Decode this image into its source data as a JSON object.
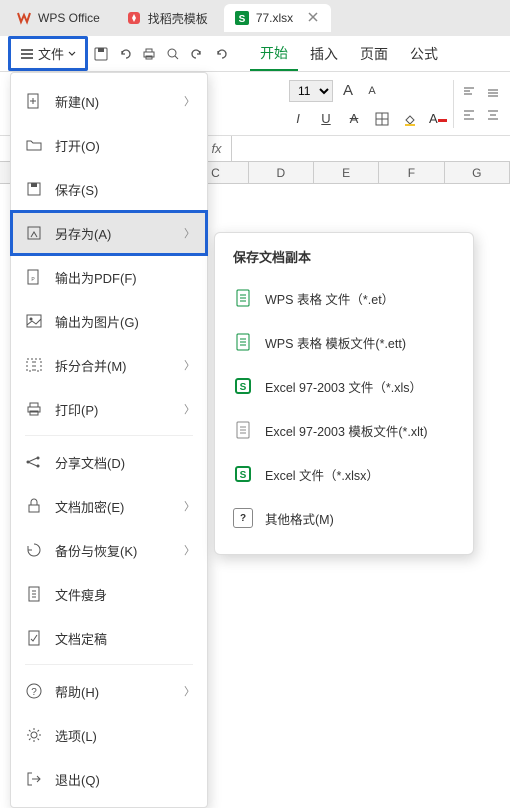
{
  "tabs": [
    {
      "label": "WPS Office",
      "icon": "wps"
    },
    {
      "label": "找稻壳模板",
      "icon": "docer"
    },
    {
      "label": "77.xlsx",
      "icon": "sheet",
      "active": true
    }
  ],
  "file_btn": "文件",
  "menu_tabs": [
    {
      "label": "开始",
      "active": true
    },
    {
      "label": "插入"
    },
    {
      "label": "页面"
    },
    {
      "label": "公式"
    }
  ],
  "ribbon": {
    "font_size": "11",
    "a_large": "A",
    "a_small": "A"
  },
  "fx_label": "fx",
  "columns": [
    "C",
    "D",
    "E",
    "F",
    "G"
  ],
  "file_menu": [
    {
      "label": "新建(N)",
      "icon": "new",
      "arrow": true
    },
    {
      "label": "打开(O)",
      "icon": "open"
    },
    {
      "label": "保存(S)",
      "icon": "save"
    },
    {
      "label": "另存为(A)",
      "icon": "saveas",
      "arrow": true,
      "highlight": true,
      "boxed": true
    },
    {
      "label": "输出为PDF(F)",
      "icon": "pdf"
    },
    {
      "label": "输出为图片(G)",
      "icon": "image"
    },
    {
      "label": "拆分合并(M)",
      "icon": "split",
      "arrow": true
    },
    {
      "label": "打印(P)",
      "icon": "print",
      "arrow": true,
      "sep_after": true
    },
    {
      "label": "分享文档(D)",
      "icon": "share"
    },
    {
      "label": "文档加密(E)",
      "icon": "lock",
      "arrow": true
    },
    {
      "label": "备份与恢复(K)",
      "icon": "backup",
      "arrow": true
    },
    {
      "label": "文件瘦身",
      "icon": "slim"
    },
    {
      "label": "文档定稿",
      "icon": "final",
      "sep_after": true
    },
    {
      "label": "帮助(H)",
      "icon": "help",
      "arrow": true
    },
    {
      "label": "选项(L)",
      "icon": "options"
    },
    {
      "label": "退出(Q)",
      "icon": "exit"
    }
  ],
  "saveas": {
    "title": "保存文档副本",
    "items": [
      {
        "label": "WPS 表格 文件（*.et）",
        "green": true
      },
      {
        "label": "WPS 表格 模板文件(*.ett)",
        "green": true
      },
      {
        "label": "Excel 97-2003 文件（*.xls）",
        "green": true,
        "bold": true
      },
      {
        "label": "Excel 97-2003 模板文件(*.xlt)"
      },
      {
        "label": "Excel 文件（*.xlsx）",
        "green": true,
        "bold": true
      },
      {
        "label": "其他格式(M)",
        "help": true
      }
    ]
  }
}
